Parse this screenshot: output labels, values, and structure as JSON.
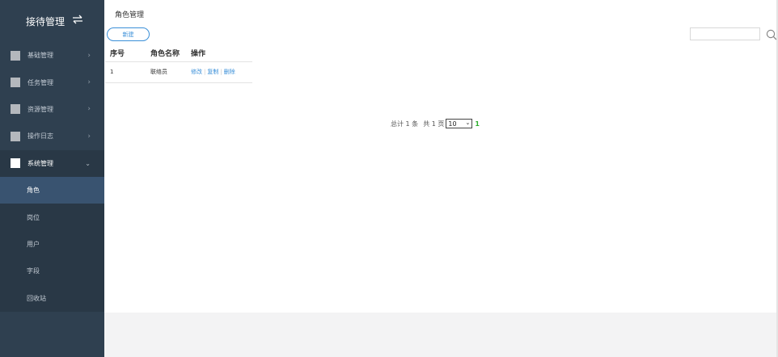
{
  "sidebar": {
    "title": "接待管理",
    "toggle_icon": "swap-icon",
    "menu": [
      {
        "label": "基础管理",
        "expanded": false
      },
      {
        "label": "任务管理",
        "expanded": false
      },
      {
        "label": "资源管理",
        "expanded": false
      },
      {
        "label": "操作日志",
        "expanded": false
      },
      {
        "label": "系统管理",
        "expanded": true
      }
    ],
    "submenu": [
      {
        "label": "角色",
        "active": true
      },
      {
        "label": "岗位",
        "active": false
      },
      {
        "label": "用户",
        "active": false
      },
      {
        "label": "字段",
        "active": false
      },
      {
        "label": "回收站",
        "active": false
      }
    ]
  },
  "main": {
    "page_title": "角色管理",
    "new_button": "新建",
    "search": {
      "value": "",
      "placeholder": ""
    },
    "table": {
      "headers": [
        "序号",
        "角色名称",
        "操作"
      ],
      "rows": [
        {
          "index": "1",
          "name": "联络员",
          "actions": [
            "修改",
            "复制",
            "删除"
          ]
        }
      ]
    },
    "pagination": {
      "total_text": "总计 1 条",
      "pages_text": "共 1 页",
      "page_size": "10",
      "current_page": "1"
    }
  },
  "colors": {
    "sidebar_bg": "#2f4050",
    "active_submenu": "#395370",
    "link": "#3a8fd8",
    "current_page": "#2dae2d"
  }
}
